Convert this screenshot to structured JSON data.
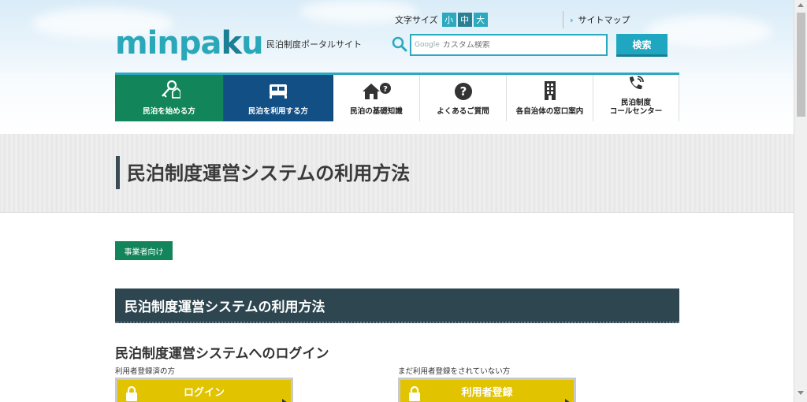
{
  "header": {
    "logo": {
      "pre": "minpa",
      "k": "k",
      "post": "u"
    },
    "tagline": "民泊制度ポータルサイト",
    "font_size": {
      "label": "文字サイズ",
      "options": [
        "小",
        "中",
        "大"
      ],
      "selected": "中"
    },
    "sitemap": "サイトマップ",
    "search": {
      "brand": "Google",
      "placeholder": "カスタム検索",
      "button": "検索"
    }
  },
  "nav": [
    {
      "label": "民泊を始める方",
      "icon": "key-house-icon"
    },
    {
      "label": "民泊を利用する方",
      "icon": "bed-icon"
    },
    {
      "label": "民泊の基礎知識",
      "icon": "house-question-icon"
    },
    {
      "label": "よくあるご質問",
      "icon": "question-circle-icon"
    },
    {
      "label": "各自治体の窓口案内",
      "icon": "building-icon"
    },
    {
      "label": "民泊制度\nコールセンター",
      "line1": "民泊制度",
      "line2": "コールセンター",
      "icon": "phone-icon"
    }
  ],
  "page_title": "民泊制度運営システムの利用方法",
  "tag": "事業者向け",
  "section_title": "民泊制度運営システムの利用方法",
  "login_heading": "民泊制度運営システムへのログイン",
  "login": {
    "registered_note": "利用者登録済の方",
    "login_button": "ログイン",
    "unregistered_note": "まだ利用者登録をされていない方",
    "register_button": "利用者登録"
  },
  "colors": {
    "accent": "#2aa9bf",
    "green": "#12855a",
    "navy": "#124f85",
    "section_bar": "#2d4650",
    "yellow": "#e1c300"
  }
}
